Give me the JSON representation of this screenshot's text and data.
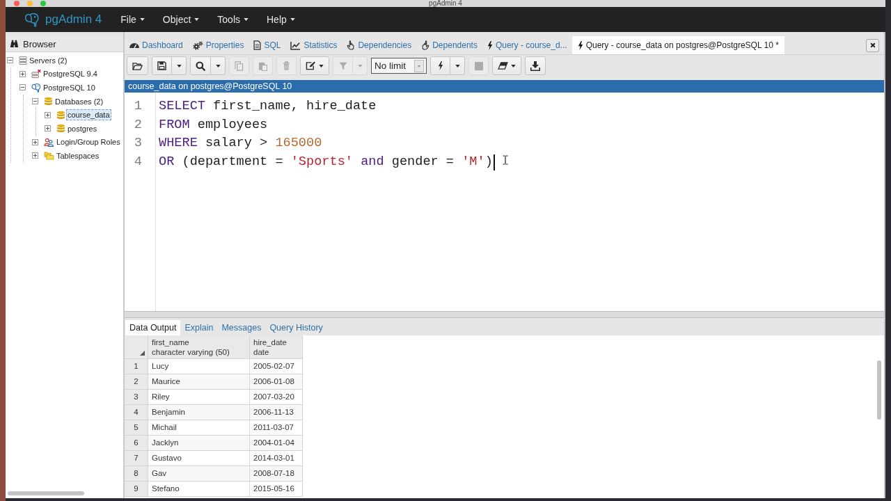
{
  "window": {
    "title": "pgAdmin 4"
  },
  "navbar": {
    "brand": "pgAdmin 4",
    "menus": [
      {
        "label": "File"
      },
      {
        "label": "Object"
      },
      {
        "label": "Tools"
      },
      {
        "label": "Help"
      }
    ]
  },
  "browser": {
    "title": "Browser",
    "tree": [
      {
        "label": "Servers (2)",
        "kind": "server_group",
        "expanded": true,
        "selected": false,
        "children": [
          {
            "label": "PostgreSQL 9.4",
            "kind": "server",
            "connected": false,
            "expanded": false,
            "selected": false
          },
          {
            "label": "PostgreSQL 10",
            "kind": "server",
            "connected": true,
            "expanded": true,
            "selected": false,
            "children": [
              {
                "label": "Databases (2)",
                "kind": "databases",
                "expanded": true,
                "selected": false,
                "children": [
                  {
                    "label": "course_data",
                    "kind": "database",
                    "expanded": false,
                    "selected": true
                  },
                  {
                    "label": "postgres",
                    "kind": "database",
                    "expanded": false,
                    "selected": false
                  }
                ]
              },
              {
                "label": "Login/Group Roles",
                "kind": "roles",
                "expanded": false,
                "selected": false
              },
              {
                "label": "Tablespaces",
                "kind": "tablespaces",
                "expanded": false,
                "selected": false
              }
            ]
          }
        ]
      }
    ]
  },
  "tabs": [
    {
      "label": "Dashboard",
      "kind": "dashboard",
      "selected": false
    },
    {
      "label": "Properties",
      "kind": "properties",
      "selected": false
    },
    {
      "label": "SQL",
      "kind": "sql",
      "selected": false
    },
    {
      "label": "Statistics",
      "kind": "statistics",
      "selected": false
    },
    {
      "label": "Dependencies",
      "kind": "dependencies",
      "selected": false
    },
    {
      "label": "Dependents",
      "kind": "dependents",
      "selected": false
    },
    {
      "label": "Query - course_d...",
      "kind": "query",
      "selected": false
    },
    {
      "label": "Query - course_data on postgres@PostgreSQL 10 *",
      "kind": "query",
      "selected": true
    }
  ],
  "toolbar": {
    "groups": [
      {
        "buttons": [
          {
            "kind": "open",
            "disabled": false
          }
        ]
      },
      {
        "buttons": [
          {
            "kind": "save",
            "disabled": false
          },
          {
            "kind": "caret",
            "disabled": false
          }
        ]
      },
      {
        "buttons": [
          {
            "kind": "find",
            "disabled": false
          },
          {
            "kind": "caret",
            "disabled": false
          }
        ]
      },
      {
        "buttons": [
          {
            "kind": "copy",
            "disabled": true
          }
        ]
      },
      {
        "buttons": [
          {
            "kind": "paste",
            "disabled": true
          }
        ]
      },
      {
        "buttons": [
          {
            "kind": "delete",
            "disabled": true
          }
        ]
      },
      {
        "buttons": [
          {
            "kind": "edit",
            "disabled": false
          }
        ]
      },
      {
        "buttons": [
          {
            "kind": "filter",
            "disabled": true
          },
          {
            "kind": "caret",
            "disabled": true
          }
        ]
      },
      {
        "buttons": [
          {
            "kind": "limit",
            "value": "No limit",
            "disabled": false
          }
        ]
      },
      {
        "buttons": [
          {
            "kind": "execute",
            "disabled": false
          },
          {
            "kind": "caret",
            "disabled": false
          }
        ]
      },
      {
        "buttons": [
          {
            "kind": "stop",
            "disabled": true
          }
        ]
      },
      {
        "buttons": [
          {
            "kind": "clear",
            "disabled": false
          }
        ]
      },
      {
        "buttons": [
          {
            "kind": "download",
            "disabled": false
          }
        ]
      }
    ]
  },
  "editor": {
    "connection": "course_data on postgres@PostgreSQL 10",
    "lines": [
      {
        "number": "1",
        "caret": false,
        "tokens": [
          {
            "kind": "keyword",
            "text": "SELECT"
          },
          {
            "kind": "plain",
            "text": " first_name, hire_date"
          }
        ]
      },
      {
        "number": "2",
        "caret": false,
        "tokens": [
          {
            "kind": "keyword",
            "text": "FROM"
          },
          {
            "kind": "plain",
            "text": " employees"
          }
        ]
      },
      {
        "number": "3",
        "caret": false,
        "tokens": [
          {
            "kind": "keyword",
            "text": "WHERE"
          },
          {
            "kind": "plain",
            "text": " salary > "
          },
          {
            "kind": "number",
            "text": "165000"
          }
        ]
      },
      {
        "number": "4",
        "caret": true,
        "tokens": [
          {
            "kind": "keyword",
            "text": "OR"
          },
          {
            "kind": "plain",
            "text": " (department = "
          },
          {
            "kind": "string",
            "text": "'Sports'"
          },
          {
            "kind": "keyword",
            "text": " and"
          },
          {
            "kind": "plain",
            "text": " gender = "
          },
          {
            "kind": "string",
            "text": "'M'"
          },
          {
            "kind": "plain",
            "text": ")"
          }
        ]
      }
    ]
  },
  "results": {
    "tabs": [
      {
        "label": "Data Output",
        "selected": true
      },
      {
        "label": "Explain",
        "selected": false
      },
      {
        "label": "Messages",
        "selected": false
      },
      {
        "label": "Query History",
        "selected": false
      }
    ],
    "columns": [
      {
        "name": "first_name",
        "type": "character varying (50)"
      },
      {
        "name": "hire_date",
        "type": "date"
      }
    ],
    "rows": [
      {
        "number": "1",
        "cells": [
          "Lucy",
          "2005-02-07"
        ]
      },
      {
        "number": "2",
        "cells": [
          "Maurice",
          "2006-01-08"
        ]
      },
      {
        "number": "3",
        "cells": [
          "Riley",
          "2007-03-20"
        ]
      },
      {
        "number": "4",
        "cells": [
          "Benjamin",
          "2006-11-13"
        ]
      },
      {
        "number": "5",
        "cells": [
          "Michail",
          "2011-03-07"
        ]
      },
      {
        "number": "6",
        "cells": [
          "Jacklyn",
          "2004-01-04"
        ]
      },
      {
        "number": "7",
        "cells": [
          "Gustavo",
          "2014-03-01"
        ]
      },
      {
        "number": "8",
        "cells": [
          "Gav",
          "2008-07-18"
        ]
      },
      {
        "number": "9",
        "cells": [
          "Stefano",
          "2015-05-16"
        ]
      }
    ]
  }
}
